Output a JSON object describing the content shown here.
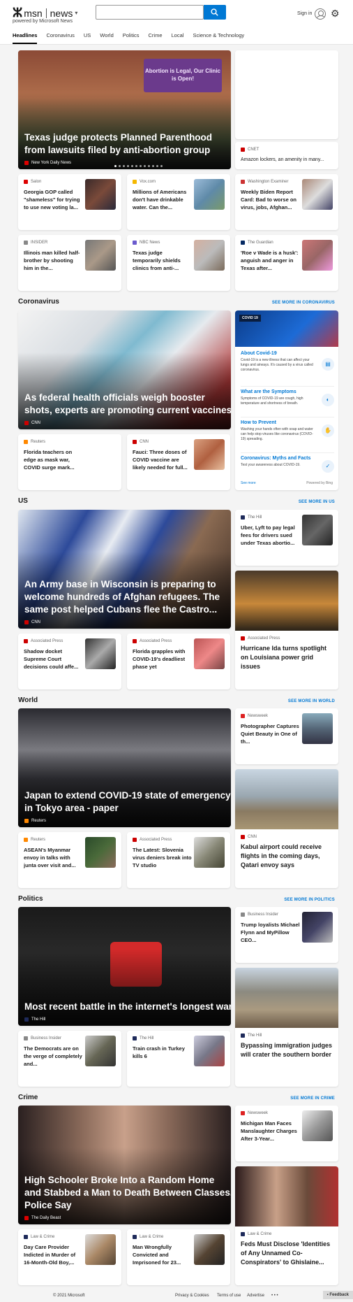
{
  "header": {
    "logo_msn": "msn",
    "logo_news": "news",
    "powered_by": "powered by Microsoft News",
    "search_placeholder": "",
    "sign_in": "Sign in"
  },
  "nav": [
    "Headlines",
    "Coronavirus",
    "US",
    "World",
    "Politics",
    "Crime",
    "Local",
    "Science & Technology"
  ],
  "top": {
    "hero": {
      "title": "Texas judge protects Planned Parenthood from lawsuits filed by anti-abortion group",
      "source": "New York Daily News",
      "sign_text": "Abortion is Legal, Our Clinic is Open!"
    },
    "side": {
      "source": "CNET",
      "title": "Amazon lockers, an amenity in many..."
    },
    "row1": [
      {
        "source": "Salon",
        "title": "Georgia GOP called \"shameless\" for trying to use new voting la..."
      },
      {
        "source": "Vox.com",
        "title": "Millions of Americans don't have drinkable water. Can the..."
      },
      {
        "source": "Washington Examiner",
        "title": "Weekly Biden Report Card: Bad to worse on virus, jobs, Afghan..."
      }
    ],
    "row2": [
      {
        "source": "INSIDER",
        "title": "Illinois man killed half-brother by shooting him in the..."
      },
      {
        "source": "NBC News",
        "title": "Texas judge temporarily shields clinics from anti-..."
      },
      {
        "source": "The Guardian",
        "title": "'Roe v Wade is a husk': anguish and anger in Texas after..."
      }
    ]
  },
  "coronavirus": {
    "heading": "Coronavirus",
    "see_more": "SEE MORE IN CORONAVIRUS",
    "hero": {
      "title": "As federal health officials weigh booster shots, experts are promoting current vaccines",
      "source": "CNN"
    },
    "row": [
      {
        "source": "Reuters",
        "title": "Florida teachers on edge as mask war, COVID surge mark..."
      },
      {
        "source": "CNN",
        "title": "Fauci: Three doses of COVID vaccine are likely needed for full..."
      }
    ],
    "widget": {
      "badge": "COVID 19",
      "items": [
        {
          "heading": "About Covid-19",
          "body": "Covid-19 is a new illness that can affect your lungs and airways. It's caused by a virus called coronavirus."
        },
        {
          "heading": "What are the Symptoms",
          "body": "Symptoms of COVID-19 are cough, high temperature and shortness of breath."
        },
        {
          "heading": "How to Prevent",
          "body": "Washing your hands often with soap and water can help stop viruses like coronavirus (COVID-19) spreading."
        },
        {
          "heading": "Coronavirus: Myths and Facts",
          "body": "Test your awareness about COVID-19."
        }
      ],
      "see_more": "See more",
      "powered": "Powered by Bing"
    }
  },
  "us": {
    "heading": "US",
    "see_more": "SEE MORE IN US",
    "hero": {
      "title": "An Army base in Wisconsin is preparing to welcome hundreds of Afghan refugees. The same post helped Cubans flee the Castro...",
      "source": "CNN"
    },
    "side": {
      "source": "The Hill",
      "title": "Uber, Lyft to pay legal fees for drivers sued under Texas abortio..."
    },
    "row": [
      {
        "source": "Associated Press",
        "title": "Shadow docket Supreme Court decisions could affe..."
      },
      {
        "source": "Associated Press",
        "title": "Florida grapples with COVID-19's deadliest phase yet"
      }
    ],
    "imgcard": {
      "source": "Associated Press",
      "title": "Hurricane Ida turns spotlight on Louisiana power grid issues"
    }
  },
  "world": {
    "heading": "World",
    "see_more": "SEE MORE IN WORLD",
    "hero": {
      "title": "Japan to extend COVID-19 state of emergency in Tokyo area - paper",
      "source": "Reuters"
    },
    "side": {
      "source": "Newsweek",
      "title": "Photographer Captures Quiet Beauty in One of th..."
    },
    "row": [
      {
        "source": "Reuters",
        "title": "ASEAN's Myanmar envoy in talks with junta over visit and..."
      },
      {
        "source": "Associated Press",
        "title": "The Latest: Slovenia virus deniers break into TV studio"
      }
    ],
    "imgcard": {
      "source": "CNN",
      "title": "Kabul airport could receive flights in the coming days, Qatari envoy says"
    }
  },
  "politics": {
    "heading": "Politics",
    "see_more": "SEE MORE IN POLITICS",
    "hero": {
      "title": "Most recent battle in the internet's longest war",
      "source": "The Hill"
    },
    "side": {
      "source": "Business Insider",
      "title": "Trump loyalists Michael Flynn and MyPillow CEO..."
    },
    "row": [
      {
        "source": "Business Insider",
        "title": "The Democrats are on the verge of completely and..."
      },
      {
        "source": "The Hill",
        "title": "Train crash in Turkey kills 6"
      }
    ],
    "imgcard": {
      "source": "The Hill",
      "title": "Bypassing immigration judges will crater the southern border"
    }
  },
  "crime": {
    "heading": "Crime",
    "see_more": "SEE MORE IN CRIME",
    "hero": {
      "title": "High Schooler Broke Into a Random Home and Stabbed a Man to Death Between Classes, Police Say",
      "source": "The Daily Beast"
    },
    "side": {
      "source": "Newsweek",
      "title": "Michigan Man Faces Manslaughter Charges After 3-Year..."
    },
    "row": [
      {
        "source": "Law & Crime",
        "title": "Day Care Provider Indicted in Murder of 16-Month-Old Boy,..."
      },
      {
        "source": "Law & Crime",
        "title": "Man Wrongfully Convicted and Imprisoned for 23..."
      }
    ],
    "imgcard": {
      "source": "Law & Crime",
      "title": "Feds Must Disclose 'Identities of Any Unnamed Co-Conspirators' to Ghislaine..."
    }
  },
  "footer": {
    "copyright": "© 2021 Microsoft",
    "privacy": "Privacy & Cookies",
    "terms": "Terms of use",
    "advertise": "Advertise",
    "more": "• • •",
    "feedback": "Feedback"
  },
  "colors": {
    "accent": "#0078d4"
  }
}
